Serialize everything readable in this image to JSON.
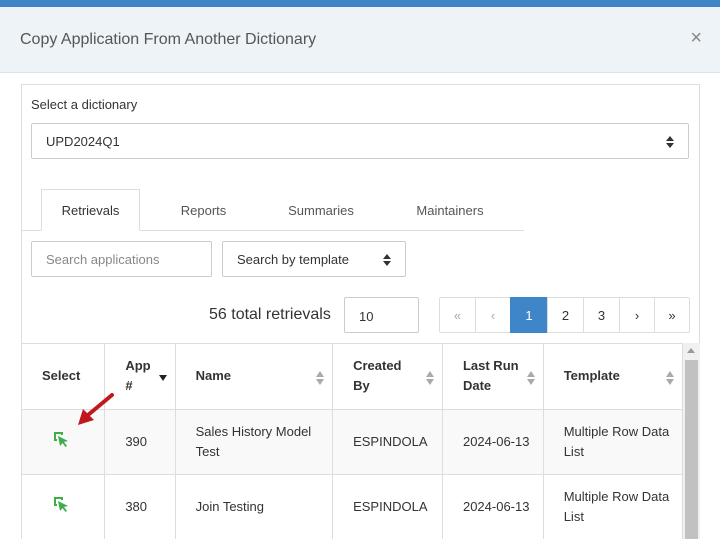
{
  "dialog": {
    "title": "Copy Application From Another Dictionary",
    "close": "×"
  },
  "dictionary": {
    "label": "Select a dictionary",
    "value": "UPD2024Q1"
  },
  "tabs": [
    {
      "label": "Retrievals",
      "active": true
    },
    {
      "label": "Reports",
      "active": false
    },
    {
      "label": "Summaries",
      "active": false
    },
    {
      "label": "Maintainers",
      "active": false
    }
  ],
  "search": {
    "placeholder": "Search applications",
    "value": ""
  },
  "template_filter": {
    "value": "Search by template"
  },
  "total_text": "56 total retrievals",
  "page_size": "10",
  "pagination": {
    "first": "«",
    "prev": "‹",
    "pages": [
      "1",
      "2",
      "3"
    ],
    "current": "1",
    "next": "›",
    "last": "»"
  },
  "table": {
    "columns": [
      "Select",
      "App #",
      "Name",
      "Created By",
      "Last Run Date",
      "Template"
    ],
    "rows": [
      {
        "app": "390",
        "name": "Sales History Model Test",
        "created_by": "ESPINDOLA",
        "last_run": "2024-06-13",
        "template": "Multiple Row Data List"
      },
      {
        "app": "380",
        "name": "Join Testing",
        "created_by": "ESPINDOLA",
        "last_run": "2024-06-13",
        "template": "Multiple Row Data List"
      }
    ]
  },
  "colors": {
    "accent": "#3f86c9",
    "select_icon": "#3cae4a",
    "annotation_arrow": "#c0181f"
  },
  "icons": {
    "select": "cursor-select-icon",
    "annotation": "red-arrow-annotation",
    "close": "close-icon"
  }
}
